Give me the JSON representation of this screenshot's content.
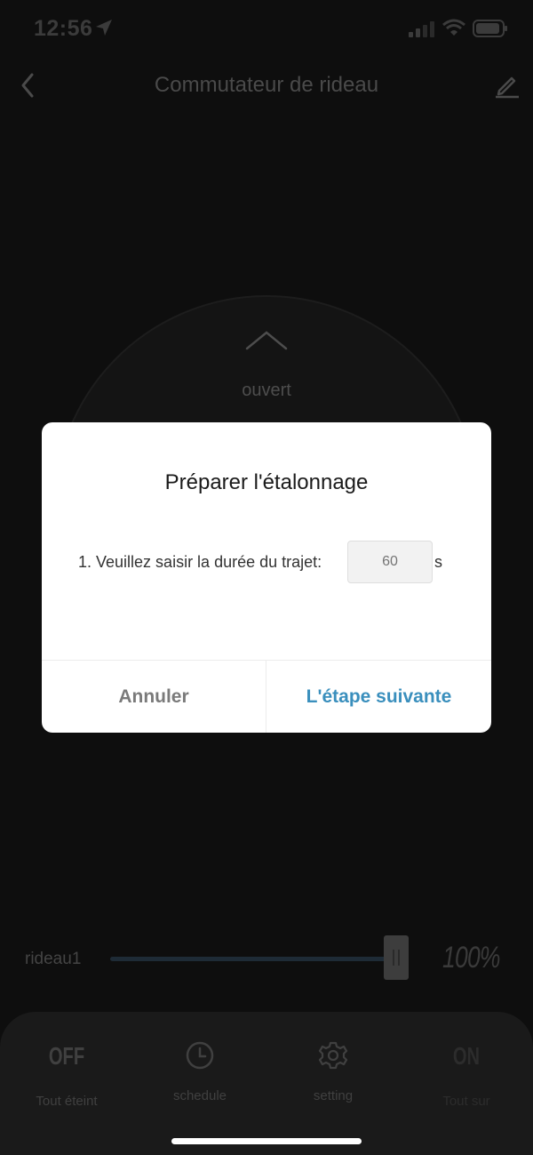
{
  "status_bar": {
    "time": "12:56",
    "icons": [
      "location-arrow-icon",
      "cellular-signal-icon",
      "wifi-icon",
      "battery-icon"
    ]
  },
  "nav": {
    "title": "Commutateur de rideau",
    "back_icon": "chevron-left-icon",
    "edit_icon": "pencil-icon"
  },
  "dial": {
    "direction_label": "ouvert"
  },
  "slider": {
    "label": "rideau1",
    "value_text": "100%",
    "value": 100
  },
  "bottom_bar": {
    "items": [
      {
        "icon_text": "OFF",
        "label": "Tout éteint"
      },
      {
        "icon": "clock-icon",
        "label": "schedule"
      },
      {
        "icon": "gear-icon",
        "label": "setting"
      },
      {
        "icon_text": "ON",
        "label": "Tout sur"
      }
    ]
  },
  "dialog": {
    "title": "Préparer l'étalonnage",
    "prompt": "1. Veuillez saisir la durée du trajet:",
    "input_placeholder": "60",
    "unit": "s",
    "cancel_label": "Annuler",
    "next_label": "L'étape suivante"
  },
  "colors": {
    "accent": "#3a8fbd",
    "background": "#0e0e0e",
    "dialog_bg": "#ffffff"
  }
}
